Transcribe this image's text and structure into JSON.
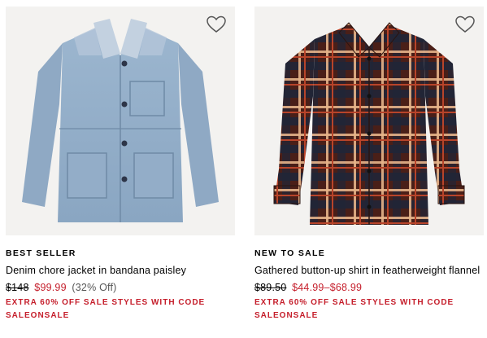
{
  "products": [
    {
      "badge": "BEST SELLER",
      "name": "Denim chore jacket in bandana paisley",
      "original_price": "$148",
      "sale_price": "$99.99",
      "discount": "(32% Off)",
      "promo": "EXTRA 60% OFF SALE STYLES WITH CODE SALEONSALE",
      "image_icon": "denim-jacket-image",
      "wishlist_icon": "heart-icon"
    },
    {
      "badge": "NEW TO SALE",
      "name": "Gathered button-up shirt in featherweight flannel",
      "original_price": "$89.50",
      "sale_price": "$44.99–$68.99",
      "promo": "EXTRA 60% OFF SALE STYLES WITH CODE SALEONSALE",
      "image_icon": "plaid-shirt-image",
      "wishlist_icon": "heart-icon"
    }
  ],
  "colors": {
    "sale": "#c51e2b",
    "image_bg": "#f3f2f0"
  }
}
